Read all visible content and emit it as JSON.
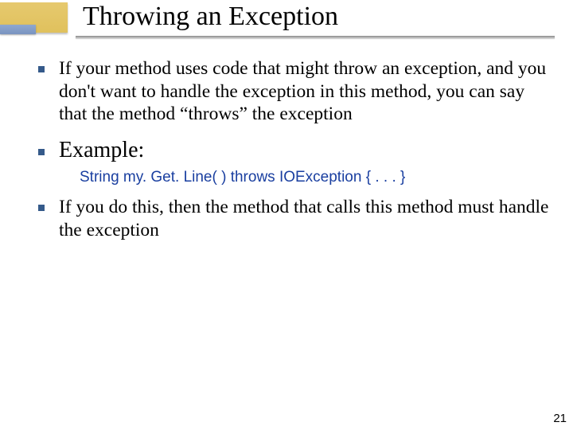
{
  "title": "Throwing an Exception",
  "bullets": {
    "b1": "If your method uses code that might throw an exception, and you don't want to handle the exception in this method, you can say that the method “throws” the exception",
    "b2": "Example:",
    "code": "String my. Get. Line( ) throws IOException { . . . }",
    "b3": "If you do this, then the method that calls this method must handle the exception"
  },
  "page_number": "21"
}
